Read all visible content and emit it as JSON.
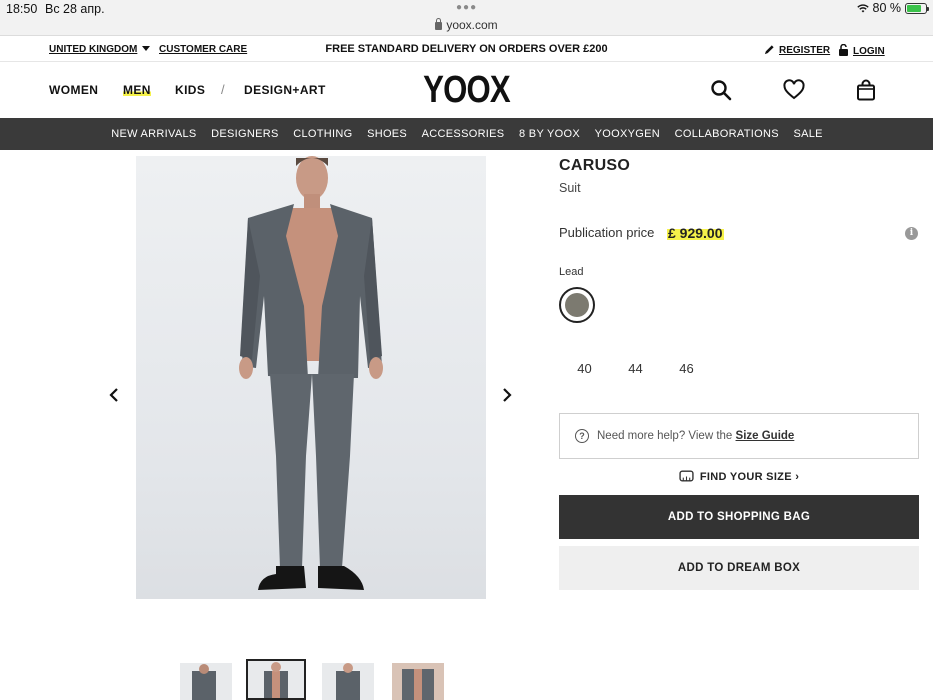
{
  "status_bar": {
    "time": "18:50",
    "date": "Вс 28 апр.",
    "url": "yoox.com",
    "battery": "80 %"
  },
  "util_bar": {
    "country": "UNITED KINGDOM",
    "customer_care": "CUSTOMER CARE",
    "delivery": "FREE STANDARD DELIVERY ON ORDERS OVER £200",
    "register": "REGISTER",
    "login": "LOGIN"
  },
  "header": {
    "nav": [
      "WOMEN",
      "MEN",
      "KIDS",
      "DESIGN+ART"
    ],
    "logo": "YOOX",
    "active_nav": "MEN"
  },
  "categories": [
    "NEW ARRIVALS",
    "DESIGNERS",
    "CLOTHING",
    "SHOES",
    "ACCESSORIES",
    "8 BY YOOX",
    "YOOXYGEN",
    "COLLABORATIONS",
    "SALE"
  ],
  "product": {
    "brand": "CARUSO",
    "type": "Suit",
    "price_label": "Publication price",
    "price": "£ 929.00",
    "color_name": "Lead",
    "color_hex": "#7c7a70",
    "sizes": [
      "40",
      "44",
      "46"
    ],
    "help_text": "Need more help? View the",
    "help_link": "Size Guide",
    "find_size": "FIND YOUR SIZE",
    "add_to_bag": "ADD TO SHOPPING BAG",
    "add_to_dream": "ADD TO DREAM BOX"
  },
  "colors": {
    "catbar_bg": "#3a3a3a",
    "highlight": "#f6f24a",
    "primary_button": "#333333"
  }
}
